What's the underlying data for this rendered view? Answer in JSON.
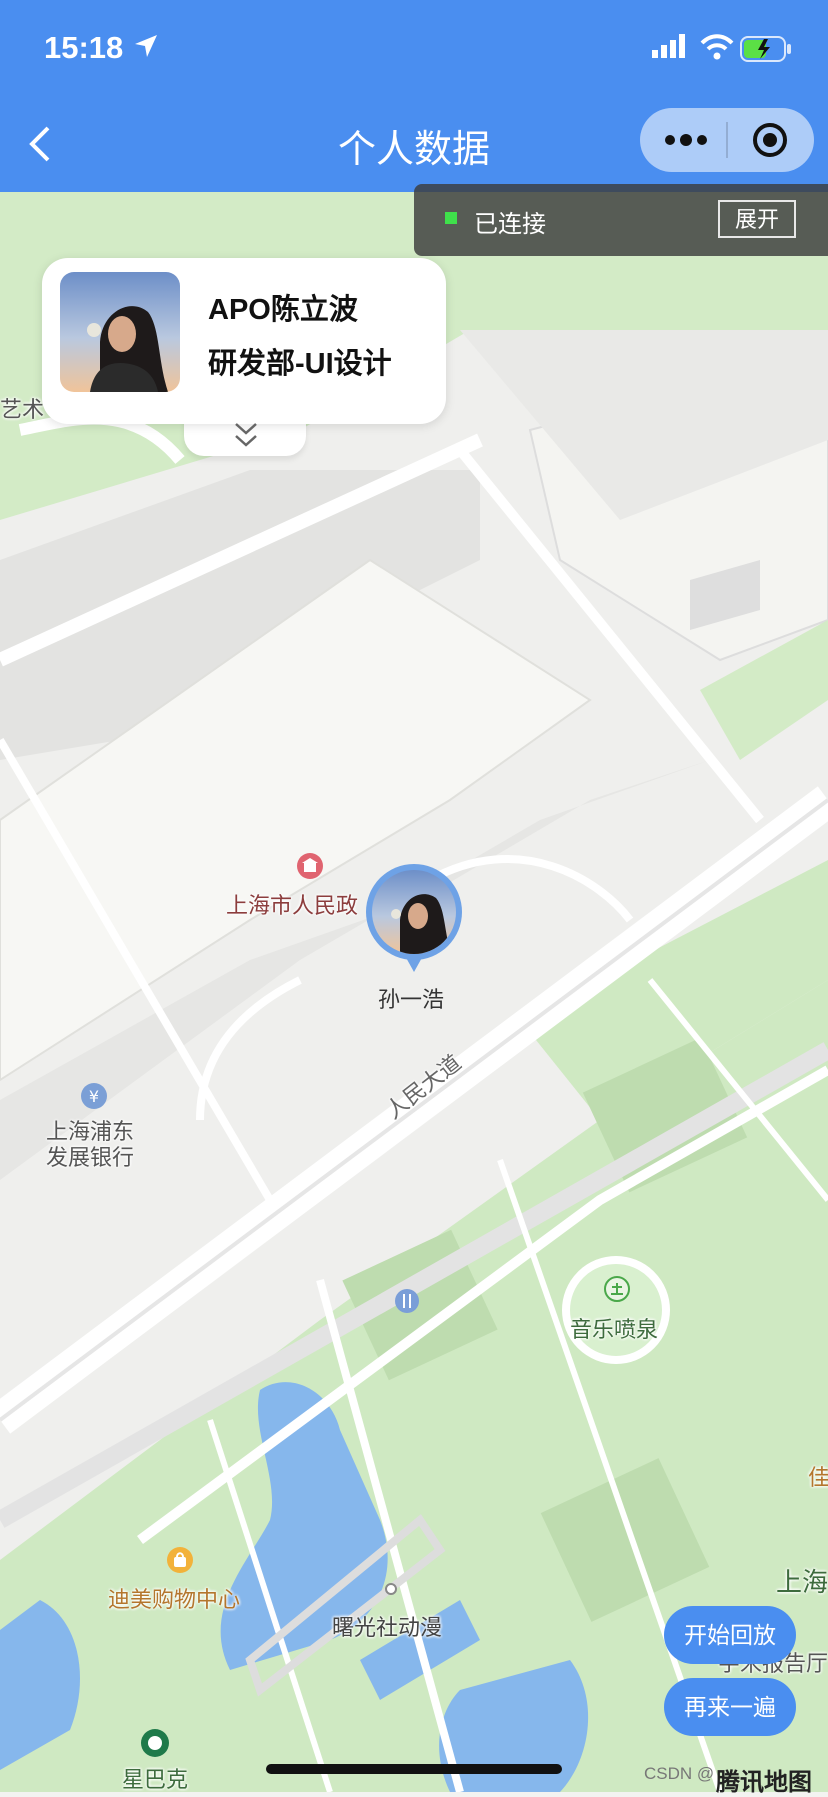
{
  "status_bar": {
    "time": "15:18"
  },
  "nav": {
    "title": "个人数据"
  },
  "connection": {
    "status_text": "已连接",
    "expand_label": "展开"
  },
  "card": {
    "name": "APO陈立波",
    "department": "研发部-UI设计"
  },
  "marker": {
    "name": "孙一浩"
  },
  "map": {
    "labels": {
      "art": "艺术",
      "gov": "上海市人民政",
      "bank_line1": "上海浦东",
      "bank_line2": "发展银行",
      "road": "人民大道",
      "fountain": "音乐喷泉",
      "mall": "迪美购物中心",
      "anime": "曙光社动漫",
      "starbucks": "星巴克",
      "shanghai": "上海",
      "jia": "佳",
      "report": "宇宋报告厅"
    }
  },
  "buttons": {
    "start_replay": "开始回放",
    "replay_again": "再来一遍"
  },
  "footer": {
    "watermark": "CSDN @",
    "map_logo": "腾讯地图"
  },
  "colors": {
    "header": "#4a8ef0",
    "park": "#cfe9c2",
    "water": "#7fb3ea",
    "road": "#ffffff",
    "block": "#e4e4e2"
  }
}
